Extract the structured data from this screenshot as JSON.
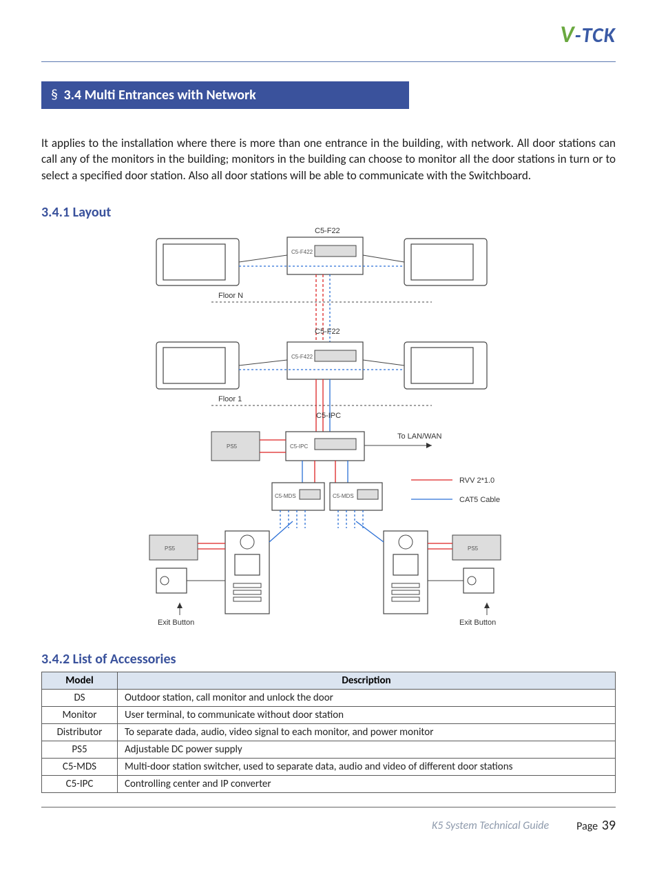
{
  "brand": {
    "v": "V",
    "rest": "-TCK"
  },
  "section": {
    "symbol": "§",
    "title": "3.4 Multi Entrances with Network"
  },
  "intro": "It applies to the installation where there is more than one entrance in the building, with network. All door stations can call any of the monitors in the building; monitors in the building can choose to monitor all the door stations in turn or to select a specified door station. Also all door stations will be able to communicate with the Switchboard.",
  "sub_layout": "3.4.1 Layout",
  "sub_accessories": "3.4.2 List of Accessories",
  "diagram": {
    "top_device": "C5-F22",
    "mid_device": "C5-F22",
    "ipc": "C5-IPC",
    "mds_left": "C5-MDS",
    "mds_right": "C5-MDS",
    "floor_n": "Floor N",
    "floor_1": "Floor 1",
    "ps5": "PS5",
    "to_lan": "To LAN/WAN",
    "legend_red": "RVV 2*1.0",
    "legend_blue": "CAT5 Cable",
    "exit_left": "Exit Button",
    "exit_right": "Exit Button",
    "f422_label": "C5-F422",
    "ipc_small": "C5-IPC"
  },
  "table": {
    "headers": [
      "Model",
      "Description"
    ],
    "rows": [
      [
        "DS",
        "Outdoor station, call monitor and unlock the door"
      ],
      [
        "Monitor",
        "User terminal, to communicate without door station"
      ],
      [
        "Distributor",
        "To separate dada, audio, video signal to each monitor, and power monitor"
      ],
      [
        "PS5",
        "Adjustable DC power supply"
      ],
      [
        "C5-MDS",
        "Multi-door station switcher, used to separate data, audio and video of different door stations"
      ],
      [
        "C5-IPC",
        "Controlling center and IP converter"
      ]
    ]
  },
  "footer": {
    "guide": "K5 System Technical Guide",
    "page_label": "Page ",
    "page_num": "39"
  }
}
